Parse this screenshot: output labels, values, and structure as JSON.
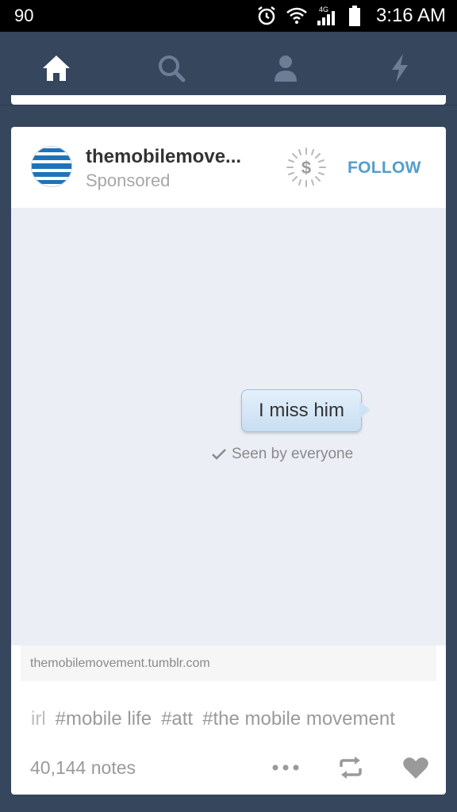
{
  "status_bar": {
    "battery_level": "90",
    "time": "3:16 AM",
    "network": "4G"
  },
  "nav": {
    "items": [
      {
        "icon": "home-icon"
      },
      {
        "icon": "search-icon"
      },
      {
        "icon": "account-icon"
      },
      {
        "icon": "activity-icon"
      }
    ],
    "active": "home"
  },
  "post": {
    "blog_name": "themobilemove...",
    "sponsored_label": "Sponsored",
    "follow_label": "FOLLOW",
    "image": {
      "bubble_text": "I miss him",
      "seen_text": "Seen by everyone"
    },
    "source": "themobilemovement.tumblr.com",
    "tags": [
      "irl",
      "#mobile life",
      "#att",
      "#the mobile movement"
    ],
    "notes": "40,144 notes"
  },
  "colors": {
    "background": "#36465d",
    "accent": "#529ecc",
    "card": "#ffffff",
    "image_bg": "#eceef6"
  }
}
